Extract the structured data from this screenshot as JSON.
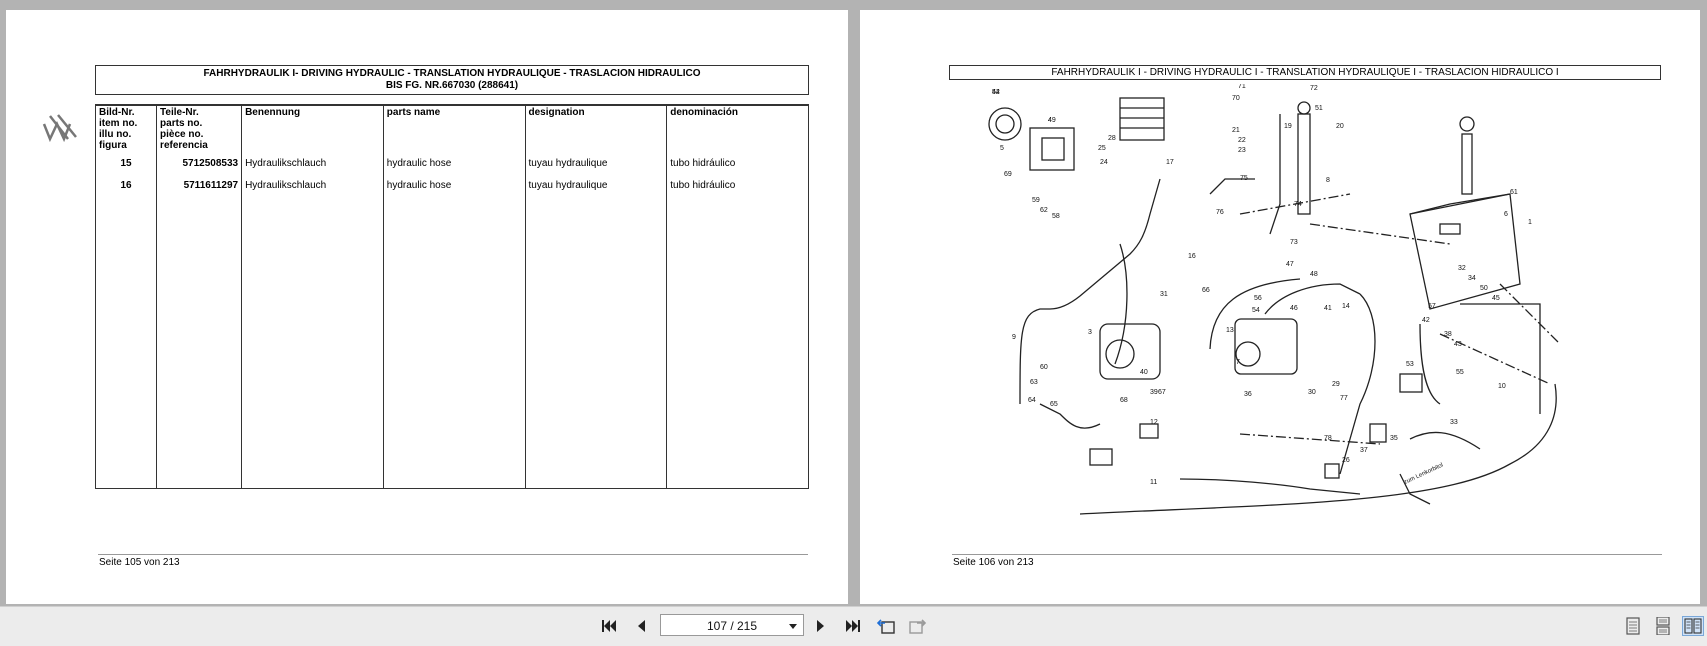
{
  "left_page": {
    "header_line1": "FAHRHYDRAULIK I- DRIVING HYDRAULIC - TRANSLATION HYDRAULIQUE - TRASLACION HIDRAULICO",
    "header_line2": "BIS FG. NR.667030  (288641)",
    "logo_text": "W/M",
    "columns": [
      {
        "lines": [
          "Bild-Nr.",
          "item no.",
          "illu no.",
          "figura"
        ]
      },
      {
        "lines": [
          "Teile-Nr.",
          "parts no.",
          "pièce no.",
          "referencia"
        ]
      },
      {
        "lines": [
          "Benennung"
        ]
      },
      {
        "lines": [
          "parts name"
        ]
      },
      {
        "lines": [
          "designation"
        ]
      },
      {
        "lines": [
          "denominación"
        ]
      }
    ],
    "rows": [
      {
        "item": "15",
        "part_no": "5712508533",
        "de": "Hydraulikschlauch",
        "en": "hydraulic hose",
        "fr": "tuyau hydraulique",
        "es": "tubo hidráulico"
      },
      {
        "item": "16",
        "part_no": "5711611297",
        "de": "Hydraulikschlauch",
        "en": "hydraulic hose",
        "fr": "tuyau hydraulique",
        "es": "tubo hidráulico"
      }
    ],
    "footer": "Seite 105 von 213"
  },
  "right_page": {
    "header": "FAHRHYDRAULIK I - DRIVING HYDRAULIC I - TRANSLATION HYDRAULIQUE I - TRASLACION HIDRAULICO I",
    "diagram_labels": [
      "52",
      "4",
      "5",
      "69",
      "59",
      "62",
      "58",
      "28",
      "25",
      "24",
      "17",
      "16",
      "66",
      "31",
      "3",
      "9",
      "60",
      "63",
      "64",
      "65",
      "68",
      "40",
      "39",
      "67",
      "12",
      "11",
      "71",
      "70",
      "21",
      "22",
      "23",
      "72",
      "51",
      "19",
      "20",
      "8",
      "75",
      "76",
      "74",
      "73",
      "14",
      "47",
      "48",
      "46",
      "56",
      "54",
      "41",
      "13",
      "7",
      "29",
      "36",
      "30",
      "77",
      "78",
      "26",
      "37",
      "35",
      "33",
      "55",
      "53",
      "10",
      "6",
      "61",
      "1",
      "57",
      "42",
      "38",
      "43",
      "32",
      "34",
      "50",
      "45",
      "44",
      "49"
    ],
    "diagram_note": "zum Lenkorbitol",
    "footer": "Seite 106 von 213"
  },
  "toolbar": {
    "page_indicator": "107 / 215",
    "first_icon": "first-page-icon",
    "prev_icon": "prev-page-icon",
    "next_icon": "next-page-icon",
    "last_icon": "last-page-icon",
    "back_icon": "go-back-icon",
    "forward_icon": "go-forward-icon",
    "single_page_icon": "single-page-view-icon",
    "continuous_icon": "continuous-view-icon",
    "facing_icon": "facing-pages-view-icon"
  }
}
